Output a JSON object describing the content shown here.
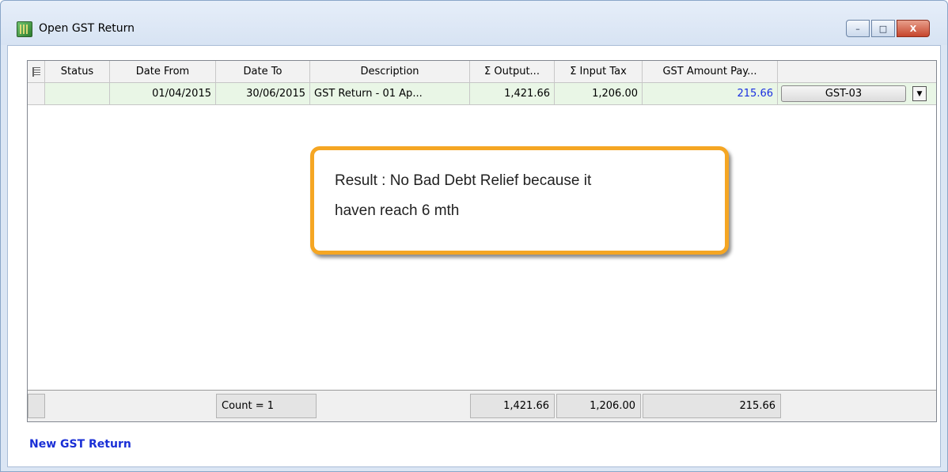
{
  "window": {
    "title": "Open GST Return",
    "buttons": {
      "minimize": "–",
      "maximize": "□",
      "close": "X"
    }
  },
  "grid": {
    "columns": [
      "Status",
      "Date From",
      "Date To",
      "Description",
      "Σ Output...",
      "Σ Input Tax",
      "GST Amount Pay..."
    ],
    "rows": [
      {
        "status": "",
        "date_from": "01/04/2015",
        "date_to": "30/06/2015",
        "description": "GST Return - 01 Ap...",
        "output": "1,421.66",
        "input_tax": "1,206.00",
        "gst_payable": "215.66",
        "form": "GST-03"
      }
    ],
    "footer": {
      "count": "Count = 1",
      "output_total": "1,421.66",
      "input_total": "1,206.00",
      "payable_total": "215.66"
    }
  },
  "callout": {
    "line1": "Result : No Bad Debt Relief because it",
    "line2": "haven reach 6 mth"
  },
  "actions": {
    "new_return": "New GST Return"
  },
  "colors": {
    "accent": "#f5a623",
    "link": "#1a2fd6",
    "row_bg": "#e9f6e6"
  }
}
